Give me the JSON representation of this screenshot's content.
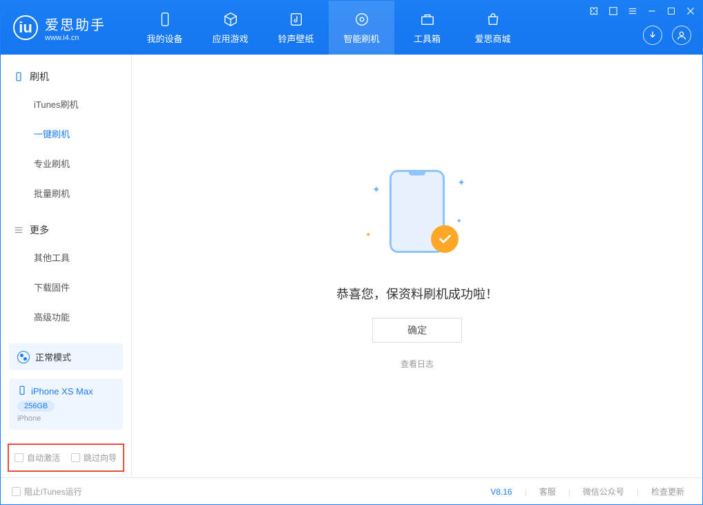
{
  "header": {
    "logo_title": "爱思助手",
    "logo_sub": "www.i4.cn",
    "nav": [
      {
        "label": "我的设备",
        "icon": "device"
      },
      {
        "label": "应用游戏",
        "icon": "cube"
      },
      {
        "label": "铃声壁纸",
        "icon": "music"
      },
      {
        "label": "智能刷机",
        "icon": "gear",
        "active": true
      },
      {
        "label": "工具箱",
        "icon": "toolbox"
      },
      {
        "label": "爱思商城",
        "icon": "bag"
      }
    ]
  },
  "sidebar": {
    "sections": [
      {
        "title": "刷机",
        "items": [
          "iTunes刷机",
          "一键刷机",
          "专业刷机",
          "批量刷机"
        ],
        "activeIndex": 1
      },
      {
        "title": "更多",
        "items": [
          "其他工具",
          "下载固件",
          "高级功能"
        ]
      }
    ],
    "mode_label": "正常模式",
    "device": {
      "name": "iPhone XS Max",
      "storage": "256GB",
      "type": "iPhone"
    },
    "checks": {
      "auto_activate": "自动激活",
      "skip_wizard": "跳过向导"
    }
  },
  "main": {
    "success_text": "恭喜您，保资料刷机成功啦！",
    "ok_button": "确定",
    "log_link": "查看日志"
  },
  "footer": {
    "block_itunes": "阻止iTunes运行",
    "version": "V8.16",
    "links": [
      "客服",
      "微信公众号",
      "检查更新"
    ]
  }
}
